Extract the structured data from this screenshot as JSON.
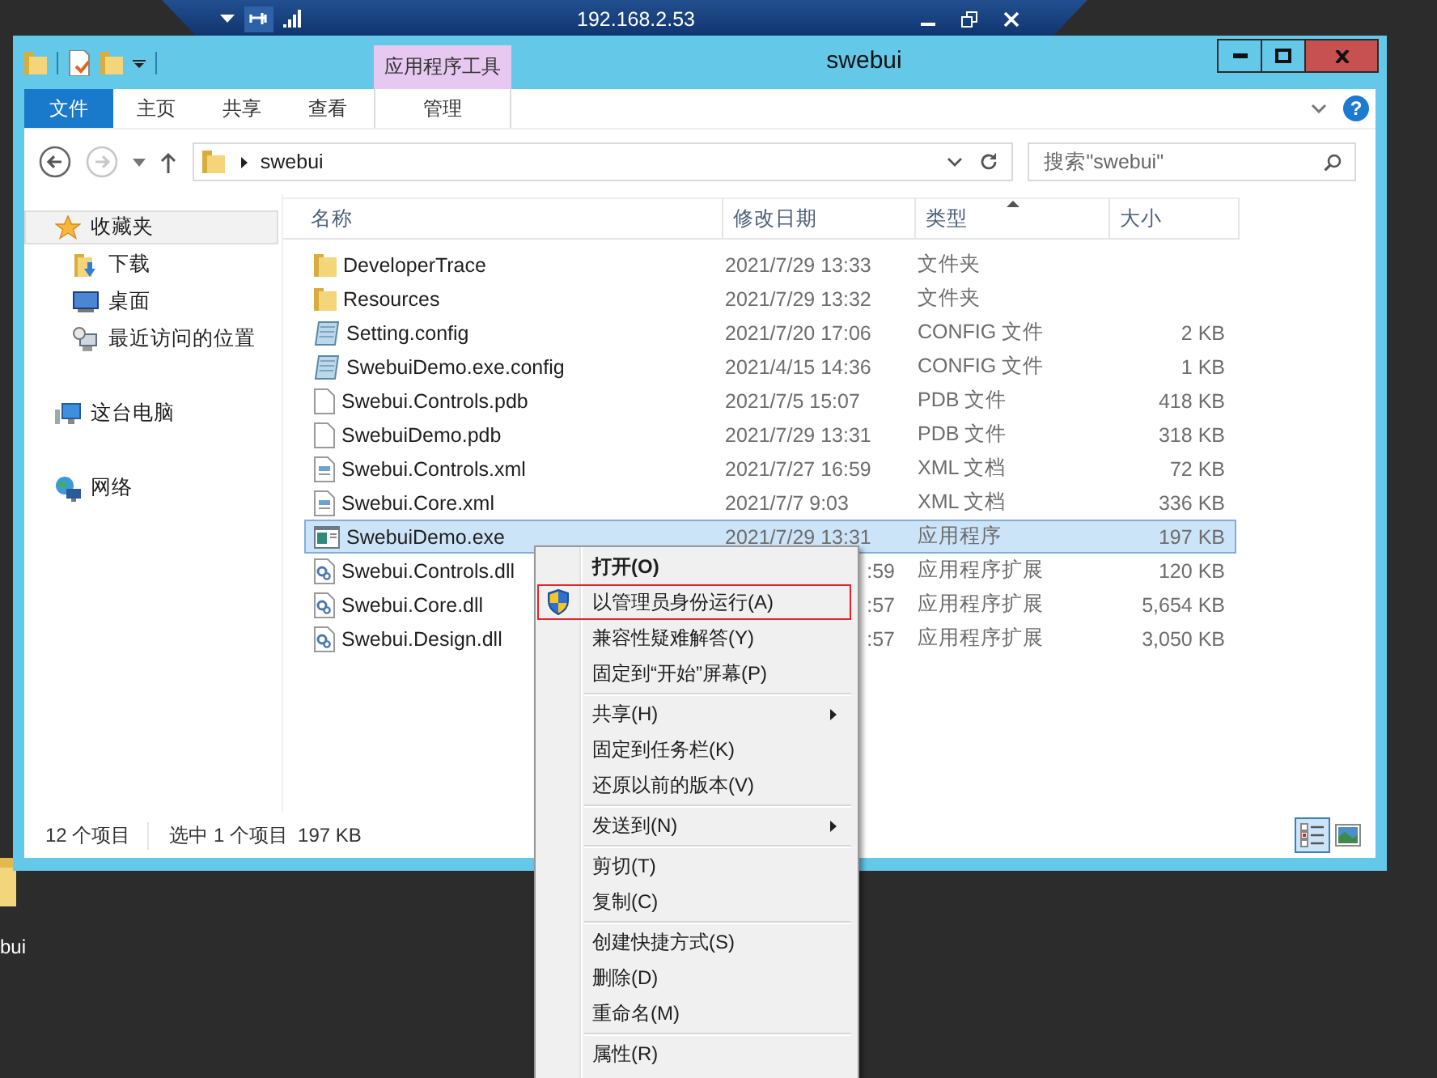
{
  "remote_bar": {
    "title": "192.168.2.53"
  },
  "window": {
    "title": "swebui",
    "contextual_group": "应用程序工具"
  },
  "ribbon": {
    "tabs": [
      {
        "label": "文件",
        "kind": "file"
      },
      {
        "label": "主页",
        "kind": "normal"
      },
      {
        "label": "共享",
        "kind": "normal"
      },
      {
        "label": "查看",
        "kind": "normal"
      },
      {
        "label": "管理",
        "kind": "contextual"
      }
    ],
    "help": "?"
  },
  "address": {
    "nav_buttons": [
      {
        "kind": "back",
        "disabled": false
      },
      {
        "kind": "forward",
        "disabled": true
      }
    ],
    "path": [
      "swebui"
    ],
    "search_placeholder": "搜索\"swebui\""
  },
  "nav_pane": [
    {
      "label": "收藏夹",
      "kind": "favorites",
      "selected": true,
      "children": [
        {
          "label": "下载",
          "kind": "downloads",
          "selected": false
        },
        {
          "label": "桌面",
          "kind": "desktop",
          "selected": false
        },
        {
          "label": "最近访问的位置",
          "kind": "recent",
          "selected": false
        }
      ]
    },
    {
      "label": "这台电脑",
      "kind": "pc",
      "selected": false
    },
    {
      "label": "网络",
      "kind": "network",
      "selected": false
    }
  ],
  "columns": [
    {
      "label": "名称",
      "sorted": false
    },
    {
      "label": "修改日期",
      "sorted": false
    },
    {
      "label": "类型",
      "sorted": true
    },
    {
      "label": "大小",
      "sorted": false
    }
  ],
  "files": [
    {
      "name": "DeveloperTrace",
      "kind": "folder",
      "date": "2021/7/29 13:33",
      "date_clipped": false,
      "type": "文件夹",
      "selected": false
    },
    {
      "name": "Resources",
      "kind": "folder",
      "date": "2021/7/29 13:32",
      "date_clipped": false,
      "type": "文件夹",
      "selected": false
    },
    {
      "name": "Setting.config",
      "kind": "config",
      "date": "2021/7/20 17:06",
      "date_clipped": false,
      "type": "CONFIG 文件",
      "size": "2 KB",
      "selected": false
    },
    {
      "name": "SwebuiDemo.exe.config",
      "kind": "config",
      "date": "2021/4/15 14:36",
      "date_clipped": false,
      "type": "CONFIG 文件",
      "size": "1 KB",
      "selected": false
    },
    {
      "name": "Swebui.Controls.pdb",
      "kind": "blank",
      "date": "2021/7/5 15:07",
      "date_clipped": false,
      "type": "PDB 文件",
      "size": "418 KB",
      "selected": false
    },
    {
      "name": "SwebuiDemo.pdb",
      "kind": "blank",
      "date": "2021/7/29 13:31",
      "date_clipped": false,
      "type": "PDB 文件",
      "size": "318 KB",
      "selected": false
    },
    {
      "name": "Swebui.Controls.xml",
      "kind": "xml",
      "date": "2021/7/27 16:59",
      "date_clipped": false,
      "type": "XML 文档",
      "size": "72 KB",
      "selected": false
    },
    {
      "name": "Swebui.Core.xml",
      "kind": "xml",
      "date": "2021/7/7 9:03",
      "date_clipped": false,
      "type": "XML 文档",
      "size": "336 KB",
      "selected": false
    },
    {
      "name": "SwebuiDemo.exe",
      "kind": "exe",
      "date": "2021/7/29 13:31",
      "date_clipped": false,
      "type": "应用程序",
      "size": "197 KB",
      "selected": true
    },
    {
      "name": "Swebui.Controls.dll",
      "kind": "dll",
      "date": ":59",
      "date_clipped": true,
      "type": "应用程序扩展",
      "size": "120 KB",
      "selected": false
    },
    {
      "name": "Swebui.Core.dll",
      "kind": "dll",
      "date": ":57",
      "date_clipped": true,
      "type": "应用程序扩展",
      "size": "5,654 KB",
      "selected": false
    },
    {
      "name": "Swebui.Design.dll",
      "kind": "dll",
      "date": ":57",
      "date_clipped": true,
      "type": "应用程序扩展",
      "size": "3,050 KB",
      "selected": false
    }
  ],
  "status_bar": {
    "item_count": "12 个项目",
    "selection": "选中 1 个项目",
    "selection_size": "197 KB",
    "views": [
      {
        "kind": "details",
        "selected": true
      },
      {
        "kind": "thumbnails",
        "selected": false
      }
    ]
  },
  "context_menu": [
    {
      "kind": "item",
      "label": "打开(O)",
      "default": true,
      "highlighted": false,
      "submenu": false
    },
    {
      "kind": "elevated",
      "label": "以管理员身份运行(A)",
      "default": false,
      "highlighted": true,
      "submenu": false
    },
    {
      "kind": "item",
      "label": "兼容性疑难解答(Y)",
      "default": false,
      "highlighted": false,
      "submenu": false
    },
    {
      "kind": "item",
      "label": "固定到“开始”屏幕(P)",
      "default": false,
      "highlighted": false,
      "submenu": false
    },
    {
      "kind": "separator"
    },
    {
      "kind": "item",
      "label": "共享(H)",
      "default": false,
      "highlighted": false,
      "submenu": true
    },
    {
      "kind": "item",
      "label": "固定到任务栏(K)",
      "default": false,
      "highlighted": false,
      "submenu": false
    },
    {
      "kind": "item",
      "label": "还原以前的版本(V)",
      "default": false,
      "highlighted": false,
      "submenu": false
    },
    {
      "kind": "separator"
    },
    {
      "kind": "item",
      "label": "发送到(N)",
      "default": false,
      "highlighted": false,
      "submenu": true
    },
    {
      "kind": "separator"
    },
    {
      "kind": "item",
      "label": "剪切(T)",
      "default": false,
      "highlighted": false,
      "submenu": false
    },
    {
      "kind": "item",
      "label": "复制(C)",
      "default": false,
      "highlighted": false,
      "submenu": false
    },
    {
      "kind": "separator"
    },
    {
      "kind": "item",
      "label": "创建快捷方式(S)",
      "default": false,
      "highlighted": false,
      "submenu": false
    },
    {
      "kind": "item",
      "label": "删除(D)",
      "default": false,
      "highlighted": false,
      "submenu": false
    },
    {
      "kind": "item",
      "label": "重命名(M)",
      "default": false,
      "highlighted": false,
      "submenu": false
    },
    {
      "kind": "separator"
    },
    {
      "kind": "item",
      "label": "属性(R)",
      "default": false,
      "highlighted": false,
      "submenu": false
    }
  ],
  "desktop_icons": [
    {
      "label": "bui"
    }
  ]
}
